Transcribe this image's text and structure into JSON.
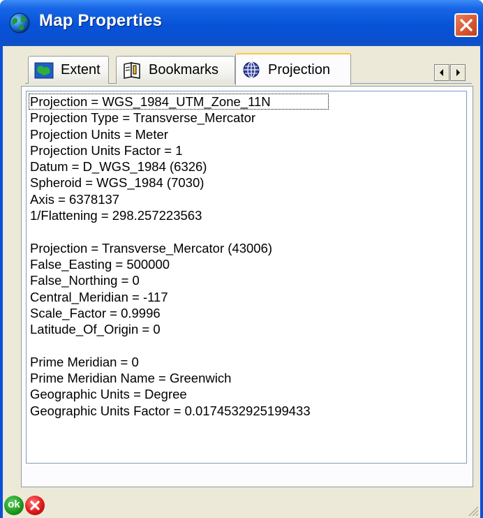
{
  "window": {
    "title": "Map Properties",
    "title_icon": "globe-icon",
    "close_icon": "close-icon"
  },
  "tabs": [
    {
      "label": "Extent",
      "icon": "map-icon",
      "selected": false
    },
    {
      "label": "Bookmarks",
      "icon": "book-icon",
      "selected": false
    },
    {
      "label": "Projection",
      "icon": "globe-grid-icon",
      "selected": true
    }
  ],
  "tab_scroll": {
    "left_icon": "arrow-left-icon",
    "right_icon": "arrow-right-icon"
  },
  "projection_info": {
    "lines": [
      "Projection = WGS_1984_UTM_Zone_11N",
      "Projection Type = Transverse_Mercator",
      "Projection Units = Meter",
      "Projection Units Factor = 1",
      "Datum = D_WGS_1984 (6326)",
      "Spheroid = WGS_1984 (7030)",
      "Axis = 6378137",
      "1/Flattening = 298.257223563",
      "",
      "Projection = Transverse_Mercator (43006)",
      "False_Easting = 500000",
      "False_Northing = 0",
      "Central_Meridian = -117",
      "Scale_Factor = 0.9996",
      "Latitude_Of_Origin = 0",
      "",
      "Prime Meridian = 0",
      "Prime Meridian Name = Greenwich",
      "Geographic Units = Degree",
      "Geographic Units Factor = 0.0174532925199433"
    ]
  },
  "footer": {
    "ok_label": "ok",
    "ok_icon": "ok-icon",
    "cancel_icon": "cancel-icon"
  },
  "colors": {
    "titlebar": "#0753d8",
    "client_bg": "#ece9d8",
    "tab_highlight": "#ffc83c"
  }
}
